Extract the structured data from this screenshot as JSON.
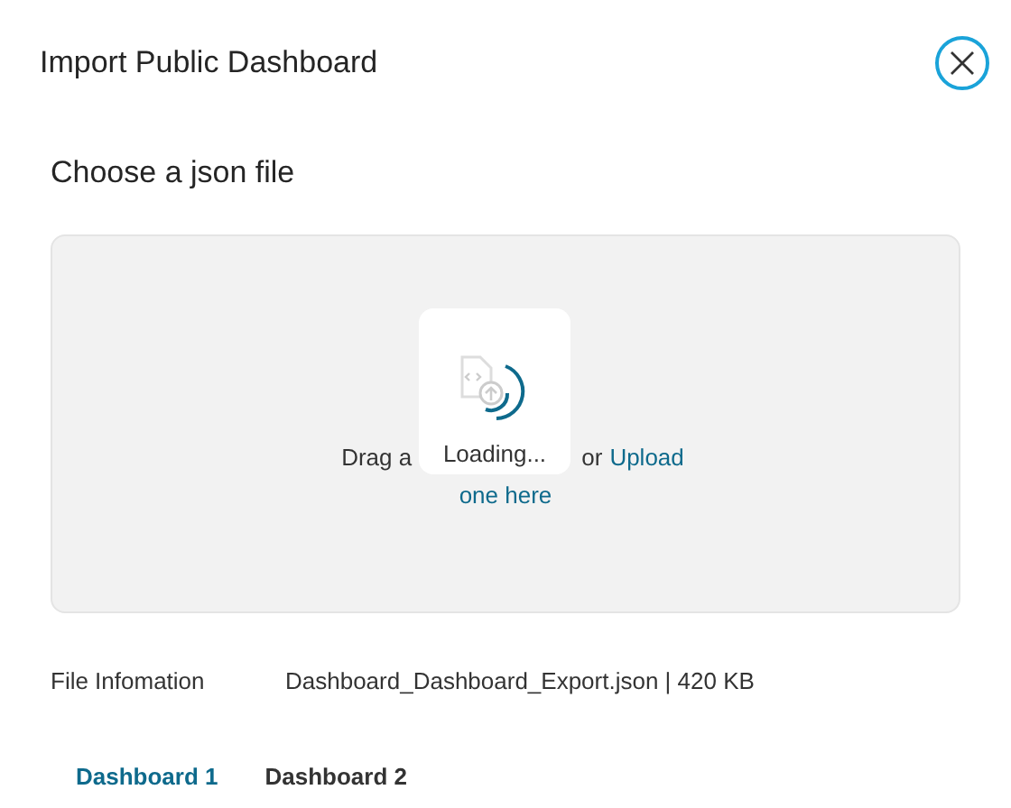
{
  "dialog": {
    "title": "Import Public Dashboard"
  },
  "section_title": "Choose a json file",
  "drop_zone": {
    "text_start": "Drag a",
    "text_middle": "or",
    "link_line_1": "Upload",
    "link_line_2": "one here"
  },
  "loading": {
    "label": "Loading..."
  },
  "file_info": {
    "label": "File Infomation",
    "value": "Dashboard_Dashboard_Export.json | 420 KB"
  },
  "tabs": [
    {
      "label": "Dashboard 1",
      "selected": true
    },
    {
      "label": "Dashboard 2",
      "selected": false
    }
  ]
}
